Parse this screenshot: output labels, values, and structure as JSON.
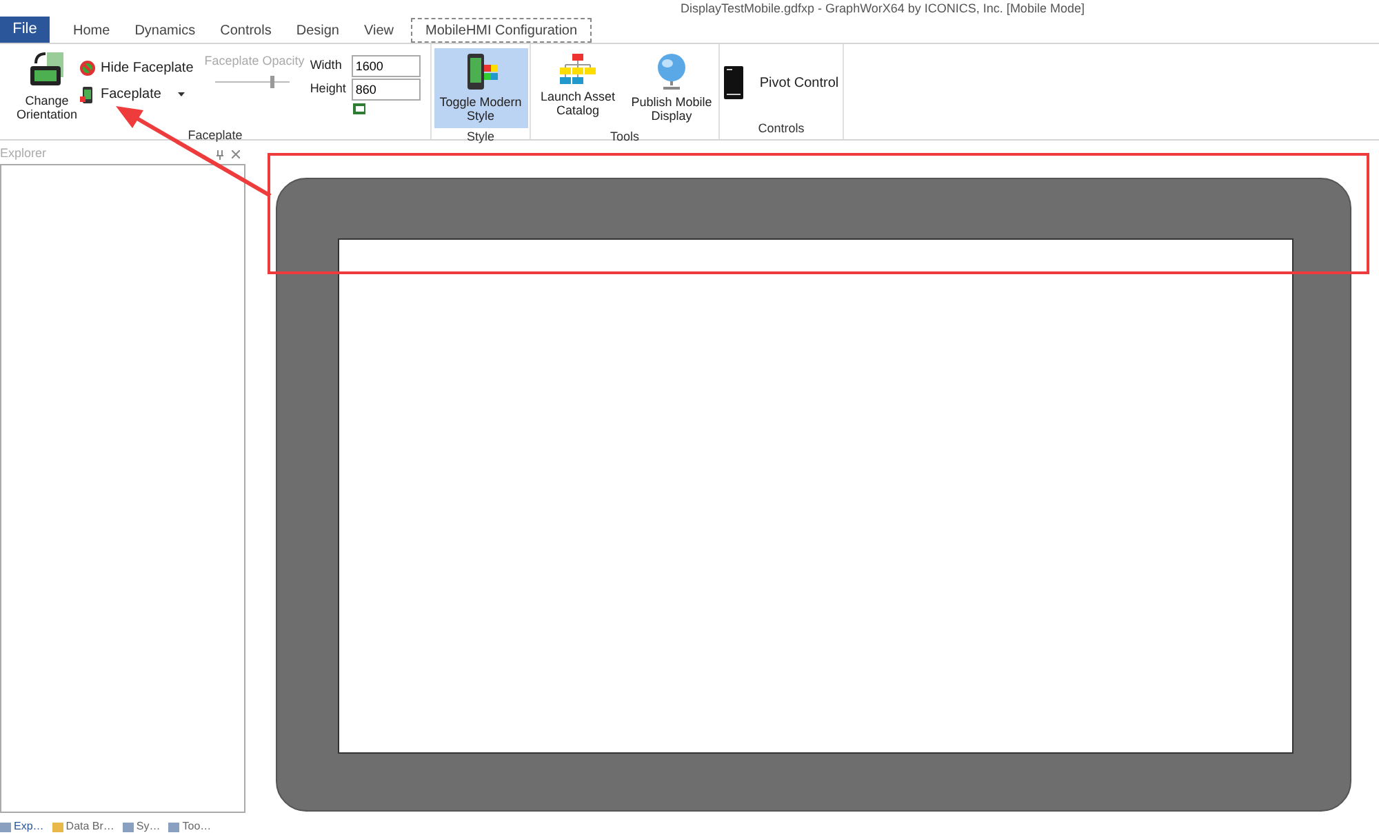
{
  "window": {
    "title": "DisplayTestMobile.gdfxp - GraphWorX64 by ICONICS, Inc. [Mobile Mode]"
  },
  "file_button": "File",
  "tabs": [
    {
      "label": "Home",
      "selected": false
    },
    {
      "label": "Dynamics",
      "selected": false
    },
    {
      "label": "Controls",
      "selected": false
    },
    {
      "label": "Design",
      "selected": false
    },
    {
      "label": "View",
      "selected": false
    },
    {
      "label": "MobileHMI Configuration",
      "selected": true
    }
  ],
  "ribbon": {
    "faceplate_group": {
      "title": "Faceplate",
      "change_orientation": "Change Orientation",
      "hide_faceplate": "Hide Faceplate",
      "faceplate": "Faceplate",
      "opacity": {
        "label": "Faceplate Opacity",
        "disabled": true,
        "level": 0.75
      },
      "width": {
        "label": "Width",
        "value": "1600"
      },
      "height": {
        "label": "Height",
        "value": "860"
      }
    },
    "style_group": {
      "title": "Style",
      "toggle": {
        "label": "Toggle Modern Style",
        "selected": true
      }
    },
    "tools_group": {
      "title": "Tools",
      "buttons": [
        "Launch Asset Catalog",
        "Publish Mobile Display"
      ]
    },
    "controls_group": {
      "title": "Controls",
      "button": "Pivot Control"
    }
  },
  "explorer": {
    "title": "Explorer"
  },
  "bottom_tabs": [
    {
      "label": "Exp…",
      "selected": true
    },
    {
      "label": "Data Br…",
      "selected": false
    },
    {
      "label": "Sy…",
      "selected": false
    },
    {
      "label": "Too…",
      "selected": false
    }
  ]
}
